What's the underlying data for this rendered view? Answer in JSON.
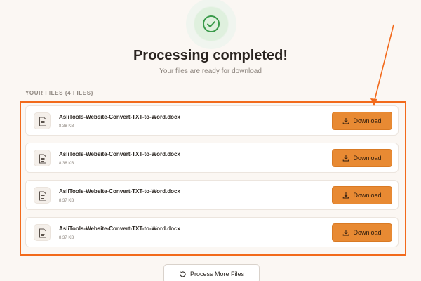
{
  "status": {
    "title": "Processing completed!",
    "subtitle": "Your files are ready for download",
    "icon": "check-circle-icon",
    "accent_color": "#3a9a4a"
  },
  "files_section": {
    "header": "YOUR FILES (4 FILES)",
    "files": [
      {
        "name": "AsliTools-Website-Convert-TXT-to-Word.docx",
        "size": "8.38 KB",
        "download_label": "Download"
      },
      {
        "name": "AsliTools-Website-Convert-TXT-to-Word.docx",
        "size": "8.38 KB",
        "download_label": "Download"
      },
      {
        "name": "AsliTools-Website-Convert-TXT-to-Word.docx",
        "size": "8.37 KB",
        "download_label": "Download"
      },
      {
        "name": "AsliTools-Website-Convert-TXT-to-Word.docx",
        "size": "8.37 KB",
        "download_label": "Download"
      }
    ]
  },
  "actions": {
    "process_more_label": "Process More Files",
    "process_more_icon": "refresh-icon"
  },
  "colors": {
    "background": "#fbf7f3",
    "download_button": "#e88a33",
    "annotation": "#f26a1b"
  }
}
